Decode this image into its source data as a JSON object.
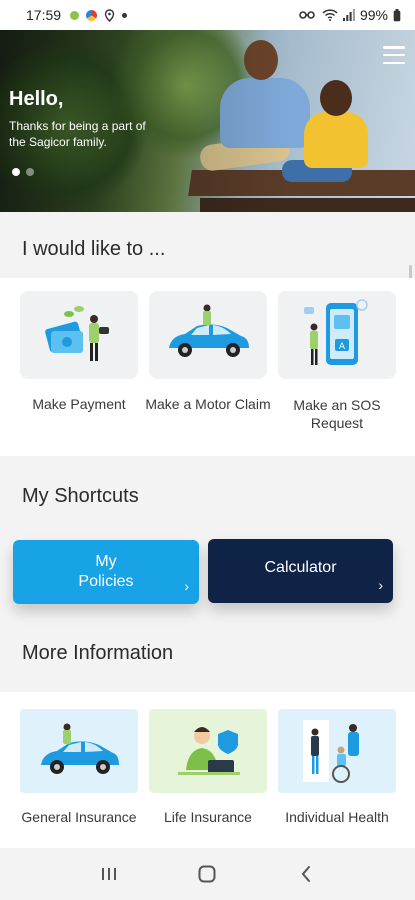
{
  "status_bar": {
    "time": "17:59",
    "battery": "99%",
    "icons": [
      "green-dot-icon",
      "chrome-icon",
      "location-icon",
      "dot-icon",
      "key-icon",
      "wifi-icon",
      "signal-icon",
      "battery-icon"
    ]
  },
  "hero": {
    "greeting": "Hello,",
    "subtitle": "Thanks for being a part of the Sagicor family.",
    "slide_count": 2,
    "active_slide": 1
  },
  "actions": {
    "title": "I would like to ...",
    "items": [
      {
        "label": "Make Payment",
        "icon": "payment-illustration"
      },
      {
        "label": "Make a Motor Claim",
        "icon": "motor-claim-illustration"
      },
      {
        "label": "Make an SOS Request",
        "icon": "sos-phone-illustration"
      }
    ]
  },
  "shortcuts": {
    "title": "My Shortcuts",
    "items": [
      {
        "label": "My Policies",
        "arrow": "›",
        "color": "#17a3e6"
      },
      {
        "label": "Calculator",
        "arrow": "›",
        "color": "#0f2346"
      }
    ]
  },
  "more_info": {
    "title": "More Information",
    "items": [
      {
        "label": "General Insurance",
        "bg": "#dff2fb"
      },
      {
        "label": "Life Insurance",
        "bg": "#e6f5d9"
      },
      {
        "label": "Individual Health",
        "bg": "#dff2fb"
      }
    ]
  },
  "nav_bar": {
    "icons": [
      "recents-icon",
      "home-icon",
      "back-icon"
    ]
  }
}
